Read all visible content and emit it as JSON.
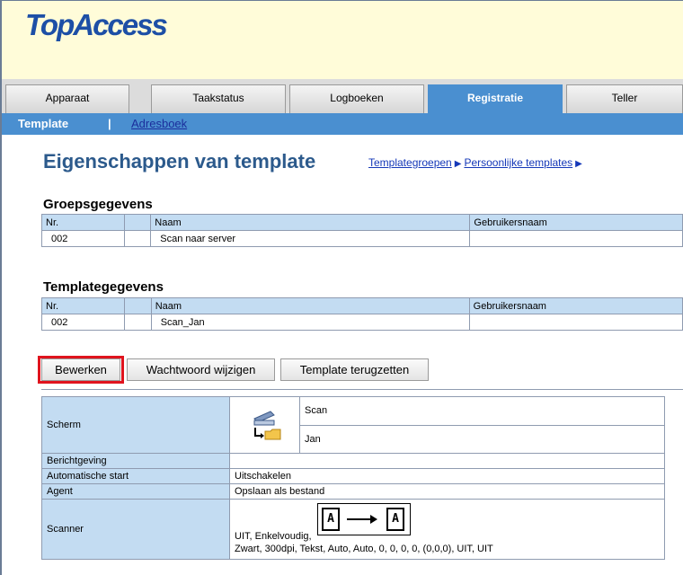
{
  "app": {
    "logo": "TopAccess"
  },
  "tabs": [
    {
      "label": "Apparaat"
    },
    {
      "label": "Taakstatus"
    },
    {
      "label": "Logboeken"
    },
    {
      "label": "Registratie",
      "active": true
    },
    {
      "label": "Teller"
    }
  ],
  "subnav": {
    "current": "Template",
    "separator": "|",
    "link": "Adresboek"
  },
  "page": {
    "title": "Eigenschappen van template",
    "breadcrumb": [
      "Templategroepen",
      "Persoonlijke templates"
    ]
  },
  "group": {
    "heading": "Groepsgegevens",
    "headers": [
      "Nr.",
      "",
      "Naam",
      "Gebruikersnaam"
    ],
    "row": [
      "002",
      "",
      "Scan naar server",
      ""
    ]
  },
  "template": {
    "heading": "Templategegevens",
    "headers": [
      "Nr.",
      "",
      "Naam",
      "Gebruikersnaam"
    ],
    "row": [
      "002",
      "",
      "Scan_Jan",
      ""
    ]
  },
  "buttons": {
    "edit": "Bewerken",
    "change_password": "Wachtwoord wijzigen",
    "reset": "Template terugzetten"
  },
  "properties": {
    "screen_label": "Scherm",
    "screen_values": [
      "Scan",
      "Jan"
    ],
    "notification_label": "Berichtgeving",
    "notification_value": "",
    "autostart_label": "Automatische start",
    "autostart_value": "Uitschakelen",
    "agent_label": "Agent",
    "agent_value": "Opslaan als bestand",
    "scanner_label": "Scanner",
    "scanner_line1": "UIT, Enkelvoudig,",
    "scanner_line2": "Zwart, 300dpi, Tekst, Auto, Auto, 0, 0, 0, 0, (0,0,0), UIT, UIT",
    "scanner_icon_text": "A"
  },
  "colors": {
    "accent": "#4a8fd0",
    "logo": "#1d4fa6",
    "banner": "#fffcd9",
    "header_cell": "#c3dcf2",
    "highlight": "#e0141e"
  }
}
